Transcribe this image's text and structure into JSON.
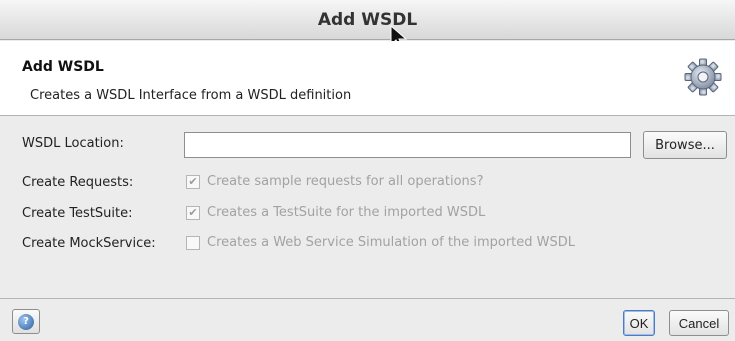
{
  "window": {
    "title": "Add WSDL"
  },
  "header": {
    "title": "Add WSDL",
    "description": "Creates a WSDL Interface from a WSDL definition",
    "icon": "gear-icon"
  },
  "form": {
    "location": {
      "label": "WSDL Location:",
      "value": "",
      "browse_label": "Browse..."
    },
    "create_requests": {
      "label": "Create Requests:",
      "checked": true,
      "text": "Create sample requests for all operations?"
    },
    "create_testsuite": {
      "label": "Create TestSuite:",
      "checked": true,
      "text": "Creates a TestSuite for the imported WSDL"
    },
    "create_mockservice": {
      "label": "Create MockService:",
      "checked": false,
      "text": "Creates a Web Service Simulation of the imported WSDL"
    }
  },
  "footer": {
    "help_icon": "help-icon",
    "ok_label": "OK",
    "cancel_label": "Cancel"
  },
  "colors": {
    "accent": "#4a7bc4",
    "disabled_text": "#a2a2a2"
  }
}
